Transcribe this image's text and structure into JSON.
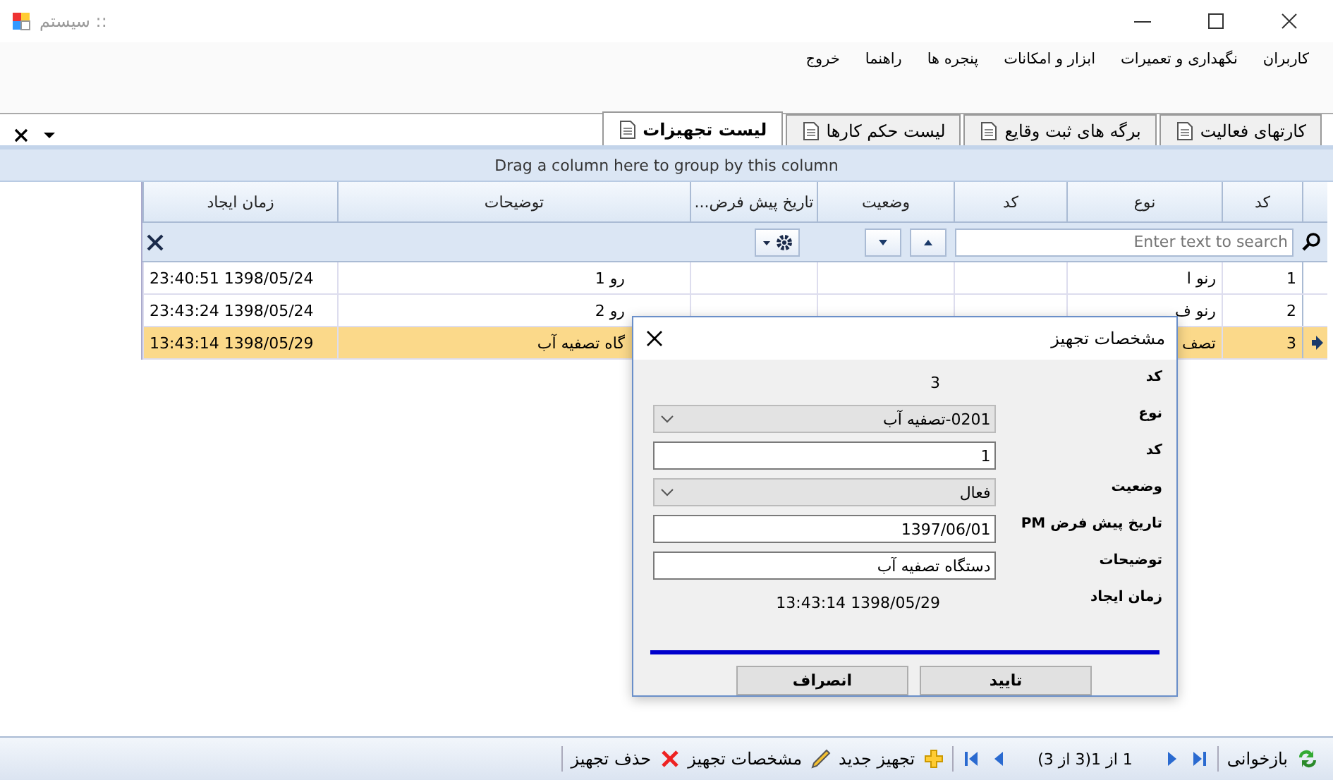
{
  "window": {
    "title": ":: سیستم"
  },
  "menu": [
    "کاربران",
    "نگهداری و تعمیرات",
    "ابزار و امکانات",
    "پنجره ها",
    "راهنما",
    "خروج"
  ],
  "tabs": [
    {
      "label": "کارتهای فعالیت",
      "selected": false
    },
    {
      "label": "برگه های ثبت وقایع",
      "selected": false
    },
    {
      "label": "لیست حکم کارها",
      "selected": false
    },
    {
      "label": "لیست تجهیزات",
      "selected": true
    }
  ],
  "group_panel": "Drag a column here to group by this column",
  "grid": {
    "columns": [
      "کد",
      "نوع",
      "کد",
      "وضعیت",
      "تاریخ پیش فرض...",
      "توضیحات",
      "زمان ایجاد"
    ],
    "search": {
      "placeholder": "Enter text to search"
    },
    "rows": [
      {
        "selected": false,
        "cells": [
          "1",
          "رنو ا",
          "",
          "",
          "",
          "رو 1",
          "1398/05/24 23:40:51"
        ]
      },
      {
        "selected": false,
        "cells": [
          "2",
          "رنو ف",
          "",
          "",
          "",
          "رو 2",
          "1398/05/24 23:43:24"
        ]
      },
      {
        "selected": true,
        "cells": [
          "3",
          "تصف",
          "",
          "",
          "",
          "گاه تصفیه آب",
          "1398/05/29 13:43:14"
        ]
      }
    ]
  },
  "dialog": {
    "title": "مشخصات تجهیز",
    "fields": [
      {
        "kind": "text",
        "label": "کد",
        "value": "3"
      },
      {
        "kind": "combo",
        "label": "نوع",
        "value": "0201-تصفیه آب"
      },
      {
        "kind": "input",
        "label": "کد",
        "value": "1"
      },
      {
        "kind": "combo",
        "label": "وضعیت",
        "value": "فعال"
      },
      {
        "kind": "input",
        "label": "تاریخ پیش فرض PM",
        "value": "1397/06/01"
      },
      {
        "kind": "input",
        "label": "توضیحات",
        "value": "دستگاه تصفیه آب"
      },
      {
        "kind": "text",
        "label": "زمان ایجاد",
        "value": "1398/05/29 13:43:14"
      }
    ],
    "buttons": [
      "تایید",
      "انصراف"
    ]
  },
  "status_bar": {
    "refresh": "بازخوانی",
    "pager": "1 از 1(3 از 3)",
    "new": "تجهیز جدید",
    "edit": "مشخصات تجهیز",
    "delete": "حذف تجهیز"
  }
}
